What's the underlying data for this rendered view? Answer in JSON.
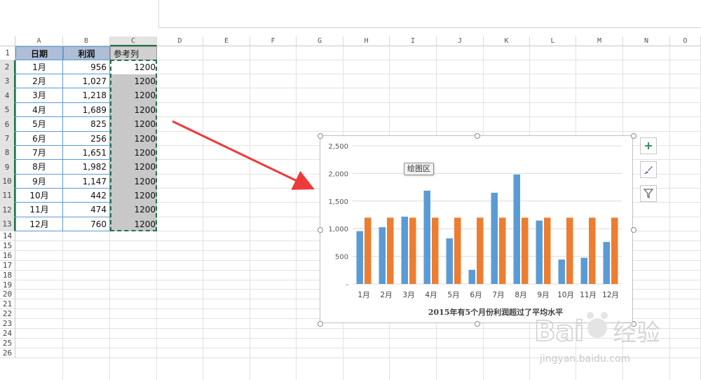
{
  "columns": [
    "A",
    "B",
    "C",
    "D",
    "E",
    "F",
    "G",
    "H",
    "I",
    "J",
    "K",
    "L",
    "M",
    "N",
    "O"
  ],
  "rows": [
    "1",
    "2",
    "3",
    "4",
    "5",
    "6",
    "7",
    "8",
    "9",
    "10",
    "11",
    "12",
    "13",
    "14",
    "15",
    "16",
    "17",
    "18",
    "19",
    "20",
    "21",
    "22",
    "23",
    "24",
    "25",
    "26"
  ],
  "table": {
    "headers": [
      "日期",
      "利润",
      "参考列"
    ],
    "months": [
      "1月",
      "2月",
      "3月",
      "4月",
      "5月",
      "6月",
      "7月",
      "8月",
      "9月",
      "10月",
      "11月",
      "12月"
    ],
    "profit": [
      "956",
      "1,027",
      "1,218",
      "1,689",
      "825",
      "256",
      "1,651",
      "1,982",
      "1,147",
      "442",
      "474",
      "760"
    ],
    "reference": [
      "1200",
      "1200",
      "1200",
      "1200",
      "1200",
      "1200",
      "1200",
      "1200",
      "1200",
      "1200",
      "1200",
      "1200"
    ]
  },
  "tooltip": "绘图区",
  "side_buttons": {
    "plus": "+",
    "brush": "✎",
    "filter": "⏷"
  },
  "colors": {
    "blue": "#5b9bd5",
    "orange": "#ed7d31",
    "header_fill": "#aebed7",
    "selection": "#217346"
  },
  "chart_data": {
    "type": "bar",
    "categories": [
      "1月",
      "2月",
      "3月",
      "4月",
      "5月",
      "6月",
      "7月",
      "8月",
      "9月",
      "10月",
      "11月",
      "12月"
    ],
    "series": [
      {
        "name": "利润",
        "values": [
          956,
          1027,
          1218,
          1689,
          825,
          256,
          1651,
          1982,
          1147,
          442,
          474,
          760
        ]
      },
      {
        "name": "参考列",
        "values": [
          1200,
          1200,
          1200,
          1200,
          1200,
          1200,
          1200,
          1200,
          1200,
          1200,
          1200,
          1200
        ]
      }
    ],
    "ytick_labels": [
      "-",
      "500",
      "1,000",
      "1,500",
      "2,000",
      "2,500"
    ],
    "yticks": [
      0,
      500,
      1000,
      1500,
      2000,
      2500
    ],
    "ylim": [
      0,
      2500
    ],
    "xlabel": "2015年有5个月份利润超过了平均水平",
    "grid": true
  },
  "watermark": {
    "brand": "Bai",
    "brand2": "经验",
    "url": "jingyan.baidu.com"
  }
}
